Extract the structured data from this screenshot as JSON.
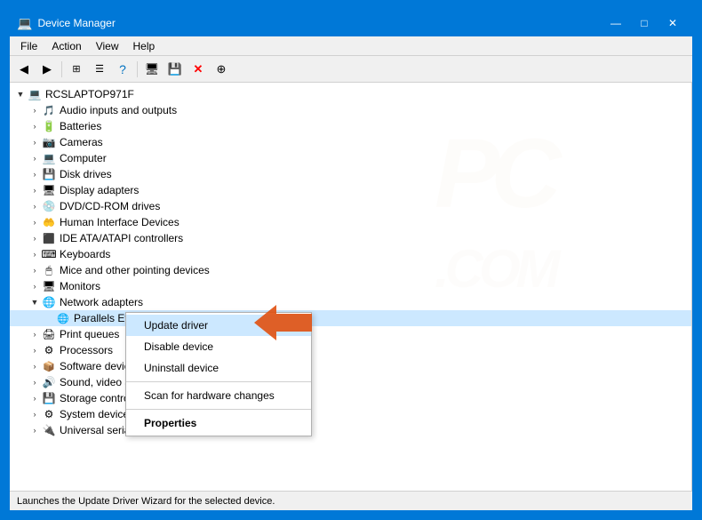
{
  "window": {
    "title": "Device Manager",
    "icon": "💻"
  },
  "titlebar": {
    "minimize": "—",
    "maximize": "□",
    "close": "✕"
  },
  "menu": {
    "items": [
      "File",
      "Action",
      "View",
      "Help"
    ]
  },
  "toolbar": {
    "buttons": [
      "◀",
      "▶",
      "⊞",
      "☰",
      "?",
      "🖥",
      "💾",
      "✕",
      "⊕"
    ]
  },
  "tree": {
    "root": "RCSLAPTOP971F",
    "items": [
      {
        "label": "Audio inputs and outputs",
        "indent": 1,
        "icon": "🎵",
        "toggle": ">"
      },
      {
        "label": "Batteries",
        "indent": 1,
        "icon": "🔋",
        "toggle": ">"
      },
      {
        "label": "Cameras",
        "indent": 1,
        "icon": "📷",
        "toggle": ">"
      },
      {
        "label": "Computer",
        "indent": 1,
        "icon": "💻",
        "toggle": ">"
      },
      {
        "label": "Disk drives",
        "indent": 1,
        "icon": "💾",
        "toggle": ">"
      },
      {
        "label": "Display adapters",
        "indent": 1,
        "icon": "🖥",
        "toggle": ">"
      },
      {
        "label": "DVD/CD-ROM drives",
        "indent": 1,
        "icon": "💿",
        "toggle": ">"
      },
      {
        "label": "Human Interface Devices",
        "indent": 1,
        "icon": "⌨",
        "toggle": ">"
      },
      {
        "label": "IDE ATA/ATAPI controllers",
        "indent": 1,
        "icon": "🔧",
        "toggle": ">"
      },
      {
        "label": "Keyboards",
        "indent": 1,
        "icon": "⌨",
        "toggle": ">"
      },
      {
        "label": "Mice and other pointing devices",
        "indent": 1,
        "icon": "🖱",
        "toggle": ">"
      },
      {
        "label": "Monitors",
        "indent": 1,
        "icon": "🖥",
        "toggle": ">"
      },
      {
        "label": "Network adapters",
        "indent": 1,
        "icon": "🌐",
        "toggle": "▼",
        "expanded": true
      },
      {
        "label": "Parallels Ethernet Adapter",
        "indent": 2,
        "icon": "🌐",
        "toggle": "",
        "selected": true
      },
      {
        "label": "Print queues",
        "indent": 1,
        "icon": "🖨",
        "toggle": ">"
      },
      {
        "label": "Processors",
        "indent": 1,
        "icon": "⚙",
        "toggle": ">"
      },
      {
        "label": "Software devices",
        "indent": 1,
        "icon": "📦",
        "toggle": ">"
      },
      {
        "label": "Sound, video and game controllers",
        "indent": 1,
        "icon": "🔊",
        "toggle": ">"
      },
      {
        "label": "Storage controllers",
        "indent": 1,
        "icon": "💾",
        "toggle": ">"
      },
      {
        "label": "System devices",
        "indent": 1,
        "icon": "⚙",
        "toggle": ">"
      },
      {
        "label": "Universal serial bus controllers",
        "indent": 1,
        "icon": "🔌",
        "toggle": ">"
      }
    ]
  },
  "contextMenu": {
    "items": [
      {
        "label": "Update driver",
        "highlighted": true,
        "bold": false
      },
      {
        "label": "Disable device",
        "highlighted": false,
        "bold": false
      },
      {
        "label": "Uninstall device",
        "highlighted": false,
        "bold": false
      },
      {
        "label": "separator"
      },
      {
        "label": "Scan for hardware changes",
        "highlighted": false,
        "bold": false
      },
      {
        "label": "separator"
      },
      {
        "label": "Properties",
        "highlighted": false,
        "bold": true
      }
    ]
  },
  "statusBar": {
    "text": "Launches the Update Driver Wizard for the selected device."
  }
}
